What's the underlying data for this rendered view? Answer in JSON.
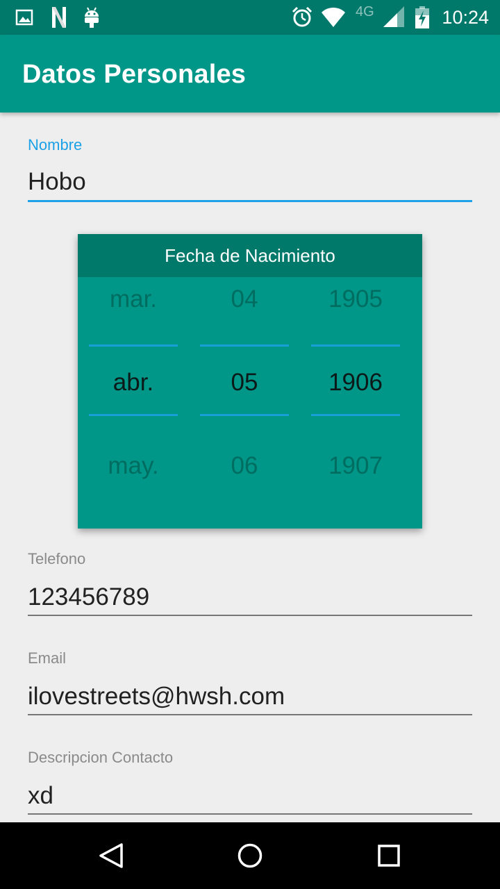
{
  "status_bar": {
    "time": "10:24",
    "network": "4G",
    "left_icons": [
      "gallery-icon",
      "n-app-icon",
      "android-icon"
    ],
    "right_icons": [
      "alarm-icon",
      "wifi-icon",
      "signal-icon",
      "battery-charging-icon"
    ]
  },
  "app_bar": {
    "title": "Datos Personales"
  },
  "form": {
    "nombre": {
      "label": "Nombre",
      "value": "Hobo"
    },
    "date_picker": {
      "title": "Fecha de Nacimiento",
      "months": {
        "prev": "mar.",
        "selected": "abr.",
        "next": "may."
      },
      "days": {
        "prev": "04",
        "selected": "05",
        "next": "06"
      },
      "years": {
        "prev": "1905",
        "selected": "1906",
        "next": "1907"
      }
    },
    "telefono": {
      "label": "Telefono",
      "value": "123456789"
    },
    "email": {
      "label": "Email",
      "value": "ilovestreets@hwsh.com"
    },
    "descripcion": {
      "label": "Descripcion Contacto",
      "value": "xd"
    }
  },
  "colors": {
    "status_bar": "#00796b",
    "app_bar": "#009688",
    "accent": "#1da1e6",
    "background": "#eeeeee"
  },
  "nav_bar": {
    "buttons": [
      "back-icon",
      "home-icon",
      "recents-icon"
    ]
  }
}
